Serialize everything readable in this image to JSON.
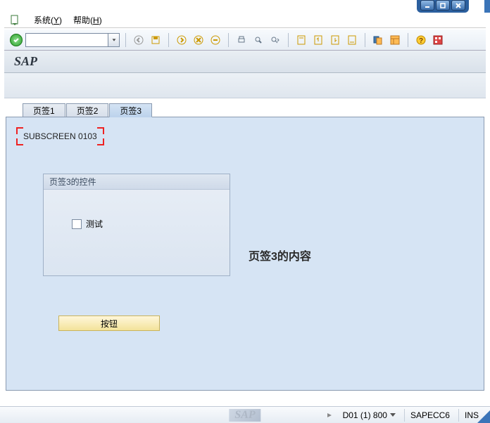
{
  "window": {
    "title": "SAP"
  },
  "menu": {
    "system": {
      "label": "系统",
      "accelerator": "Y"
    },
    "help": {
      "label": "帮助",
      "accelerator": "H"
    }
  },
  "toolbar": {
    "command_value": ""
  },
  "icons": {
    "enter": "enter-check-icon",
    "back": "back-icon",
    "save": "save-icon",
    "exit": "exit-icon",
    "cancel": "cancel-icon",
    "print": "print-icon",
    "find": "find-icon",
    "findnext": "find-next-icon",
    "first": "first-page-icon",
    "prev": "prev-page-icon",
    "next": "next-page-icon",
    "last": "last-page-icon",
    "newsession": "new-session-icon",
    "layout": "layout-icon",
    "help": "help-icon",
    "custom": "custom-icon"
  },
  "tabs": [
    {
      "label": "页签1",
      "active": false
    },
    {
      "label": "页签2",
      "active": false
    },
    {
      "label": "页签3",
      "active": true
    }
  ],
  "subscreen": {
    "label": "SUBSCREEN 0103"
  },
  "groupbox": {
    "title": "页签3的控件",
    "checkbox_label": "测试",
    "checkbox_checked": false
  },
  "content_label": "页签3的内容",
  "button_label": "按钮",
  "statusbar": {
    "logo": "SAP",
    "system": "D01 (1) 800",
    "host": "SAPECC6",
    "mode": "INS"
  },
  "colors": {
    "accent_blue": "#3b74b8",
    "tab_active": "#bdd3ec",
    "body_bg": "#d6e4f4",
    "button_yellow": "#f3e39a",
    "bracket_red": "#e22"
  }
}
